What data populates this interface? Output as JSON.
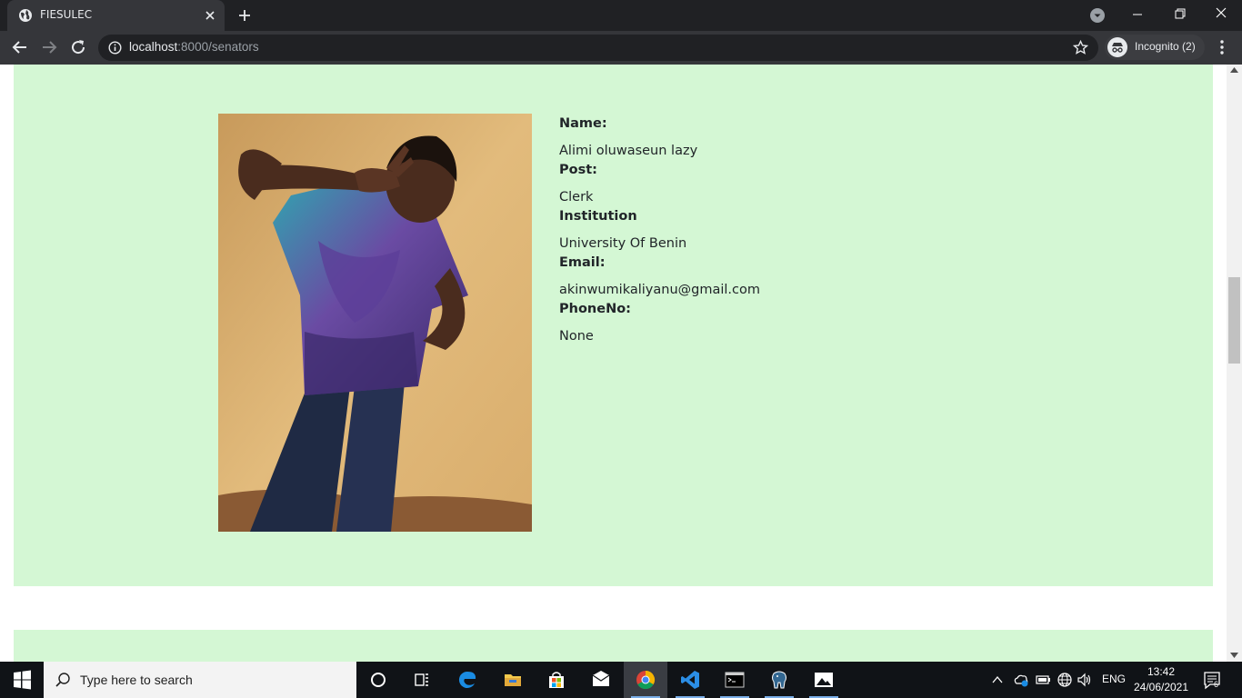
{
  "browser": {
    "tab_title": "FIESULEC",
    "url_host": "localhost",
    "url_path": ":8000/senators",
    "profile_label": "Incognito (2)"
  },
  "profile": {
    "name_label": "Name:",
    "name_value": "Alimi oluwaseun lazy",
    "post_label": "Post:",
    "post_value": "Clerk",
    "institution_label": "Institution",
    "institution_value": "University Of Benin",
    "email_label": "Email:",
    "email_value": "akinwumikaliyanu@gmail.com",
    "phone_label": "PhoneNo:",
    "phone_value": "None"
  },
  "taskbar": {
    "search_placeholder": "Type here to search",
    "language": "ENG",
    "time": "13:42",
    "date": "24/06/2021",
    "notification_count": "6"
  },
  "colors": {
    "card_background": "#d4f7d4",
    "chrome_dark": "#202124",
    "taskbar": "#101317"
  }
}
